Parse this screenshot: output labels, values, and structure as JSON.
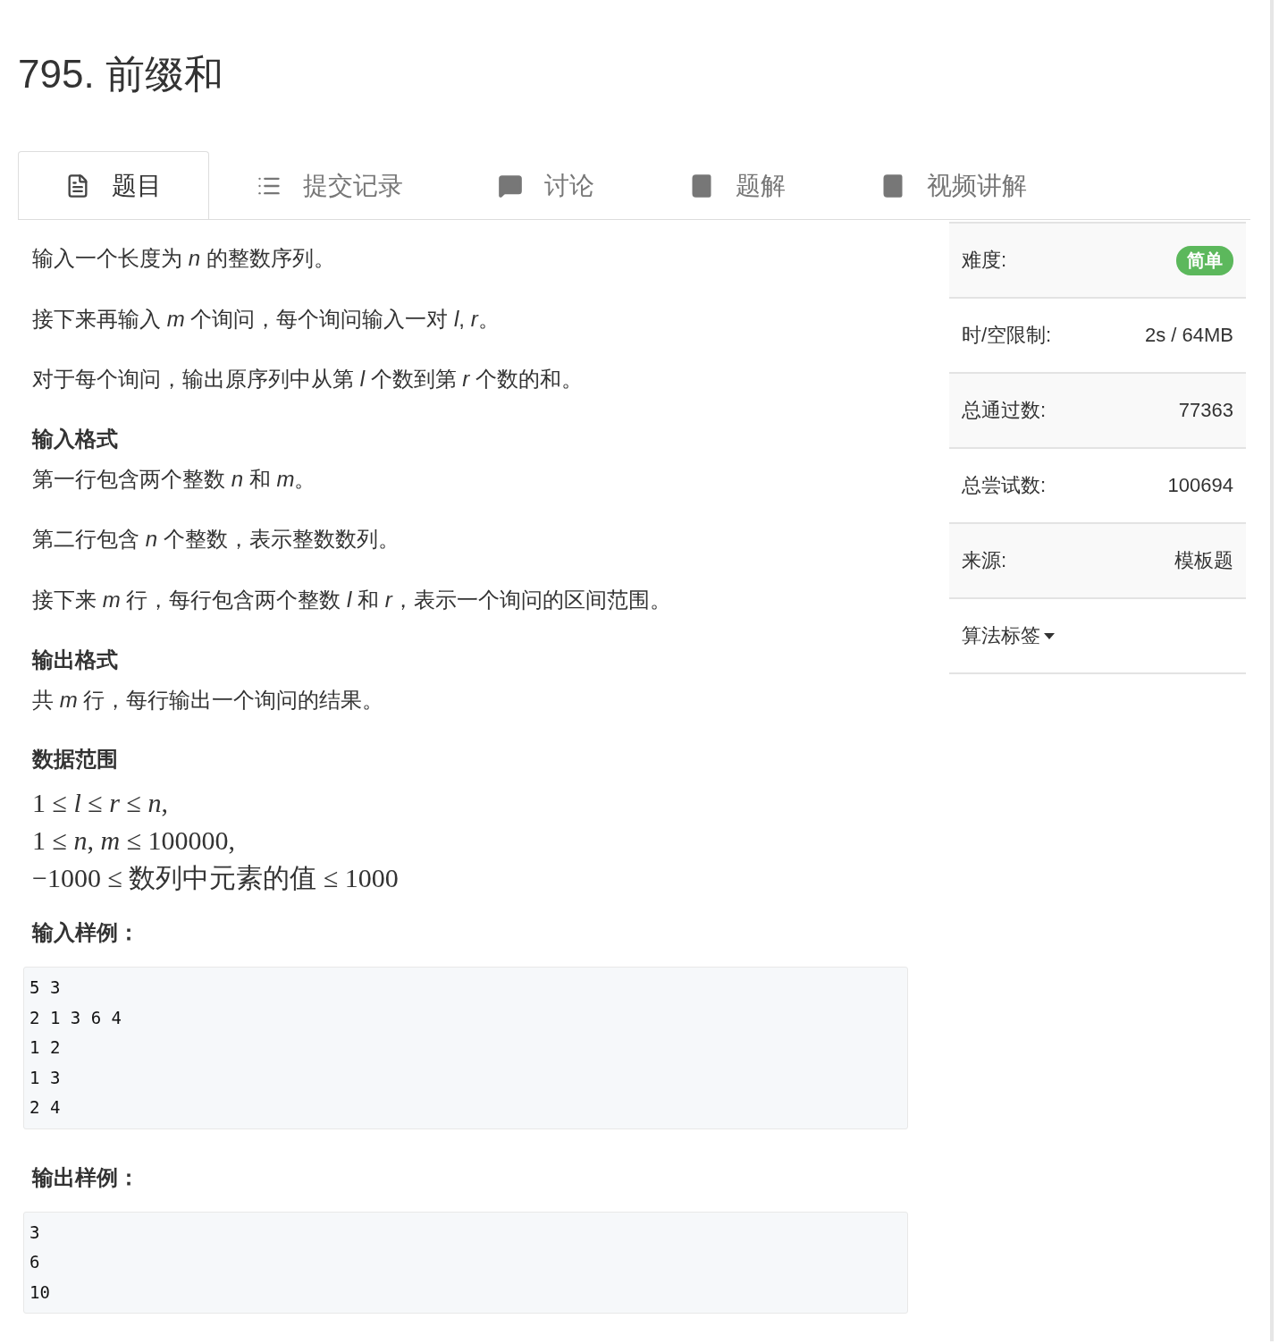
{
  "title": "795. 前缀和",
  "tabs": [
    {
      "label": "题目",
      "kind": "doc",
      "selected": true
    },
    {
      "label": "提交记录",
      "kind": "list",
      "selected": false
    },
    {
      "label": "讨论",
      "kind": "chat",
      "selected": false
    },
    {
      "label": "题解",
      "kind": "book",
      "selected": false
    },
    {
      "label": "视频讲解",
      "kind": "book",
      "selected": false
    }
  ],
  "content": [
    {
      "kind": "paragraph",
      "text": "输入一个长度为 *n* 的整数序列。"
    },
    {
      "kind": "paragraph",
      "text": "接下来再输入 *m* 个询问，每个询问输入一对 *l*, *r*。"
    },
    {
      "kind": "paragraph",
      "text": "对于每个询问，输出原序列中从第 *l* 个数到第 *r* 个数的和。"
    },
    {
      "kind": "heading",
      "text": "输入格式"
    },
    {
      "kind": "paragraph",
      "text": "第一行包含两个整数 *n* 和 *m*。"
    },
    {
      "kind": "paragraph",
      "text": "第二行包含 *n* 个整数，表示整数数列。"
    },
    {
      "kind": "paragraph",
      "text": "接下来 *m* 行，每行包含两个整数 *l* 和 *r*，表示一个询问的区间范围。"
    },
    {
      "kind": "heading",
      "text": "输出格式"
    },
    {
      "kind": "paragraph",
      "text": "共 *m* 行，每行输出一个询问的结果。"
    },
    {
      "kind": "heading",
      "text": "数据范围"
    },
    {
      "kind": "math",
      "text": "1 ≤ *l* ≤ *r* ≤ *n*,"
    },
    {
      "kind": "math",
      "text": "1 ≤ *n*, *m* ≤ 100000,"
    },
    {
      "kind": "math",
      "text": "−1000 ≤ 数列中元素的值 ≤ 1000"
    },
    {
      "kind": "heading",
      "text": "输入样例："
    },
    {
      "kind": "code",
      "text": "5 3\n2 1 3 6 4\n1 2\n1 3\n2 4"
    },
    {
      "kind": "heading",
      "text": "输出样例："
    },
    {
      "kind": "code",
      "text": "3\n6\n10"
    }
  ],
  "info": [
    {
      "label": "难度:",
      "kind": "badge",
      "value": "简单",
      "color": "#5cb85c"
    },
    {
      "label": "时/空限制:",
      "kind": "text",
      "value": "2s / 64MB"
    },
    {
      "label": "总通过数:",
      "kind": "text",
      "value": "77363"
    },
    {
      "label": "总尝试数:",
      "kind": "text",
      "value": "100694"
    },
    {
      "label": "来源:",
      "kind": "text",
      "value": "模板题"
    },
    {
      "label": "算法标签",
      "kind": "dropdown"
    }
  ]
}
